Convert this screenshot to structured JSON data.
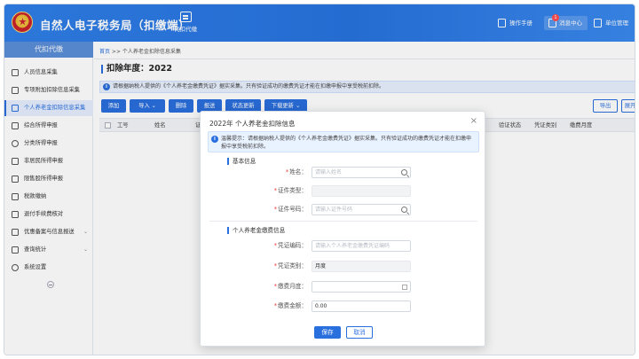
{
  "header": {
    "app_title": "自然人电子税务局（扣缴端）",
    "top_tab_label": "代扣代缴",
    "buttons": [
      {
        "label": "操作手册",
        "icon": "manual-icon"
      },
      {
        "label": "消息中心",
        "icon": "bell-icon",
        "badge": "1"
      },
      {
        "label": "单位管理",
        "icon": "building-icon"
      }
    ],
    "colors": {
      "primary": "#2a6fde",
      "header_bg": "#2f7fe8"
    }
  },
  "sidebar": {
    "head": "代扣代缴",
    "items": [
      {
        "label": "人员信息采集",
        "active": false
      },
      {
        "label": "专项附加扣除信息采集",
        "active": false
      },
      {
        "label": "个人养老金扣除信息采集",
        "active": true
      },
      {
        "label": "综合所得申报",
        "active": false
      },
      {
        "label": "分类所得申报",
        "active": false
      },
      {
        "label": "非居民所得申报",
        "active": false
      },
      {
        "label": "限售股所得申报",
        "active": false
      },
      {
        "label": "税款缴纳",
        "active": false
      },
      {
        "label": "退付手续费核对",
        "active": false
      },
      {
        "label": "优惠备案与信息报送",
        "active": false,
        "expandable": true
      },
      {
        "label": "查询统计",
        "active": false,
        "expandable": true
      },
      {
        "label": "系统设置",
        "active": false
      }
    ]
  },
  "main": {
    "breadcrumb_home": "首页",
    "breadcrumb_rest": " >> 个人养老金扣除信息采集",
    "year_title": "扣除年度：2022",
    "notice": "请根据纳税人提供的《个人养老金缴费凭证》据实采集。只有验证成功的缴费凭证才能在扣缴申报中享受税前扣除。",
    "toolbar": {
      "add": "添加",
      "import": "导入",
      "delete": "删除",
      "report": "报送",
      "status_update": "状态更新",
      "download_update": "下载更新",
      "export": "导出",
      "more": "展开"
    },
    "columns": [
      "工号",
      "姓名",
      "证",
      "验证状态",
      "凭证类别",
      "缴费月度"
    ]
  },
  "modal": {
    "title": "2022年 个人养老金扣除信息",
    "close": "×",
    "tip": "温馨提示：请根据纳税人提供的《个人养老金缴费凭证》据实采集。只有验证成功的缴费凭证才能在扣缴申报中享受税前扣除。",
    "sections": {
      "basic": "基本信息",
      "payment": "个人养老金缴费信息"
    },
    "fields": {
      "name": {
        "label": "姓名：",
        "placeholder": "请输入姓名",
        "value": ""
      },
      "id_type": {
        "label": "证件类型：",
        "value": ""
      },
      "id_number": {
        "label": "证件号码：",
        "placeholder": "请输入证件号码",
        "value": ""
      },
      "voucher_code": {
        "label": "凭证编码：",
        "placeholder": "请输入个人养老金缴费凭证编码",
        "value": ""
      },
      "voucher_type": {
        "label": "凭证类别：",
        "value": "月度"
      },
      "pay_month": {
        "label": "缴费月度：",
        "value": ""
      },
      "pay_amount": {
        "label": "缴费金额：",
        "value": "0.00"
      }
    },
    "save": "保存",
    "cancel": "取消"
  }
}
